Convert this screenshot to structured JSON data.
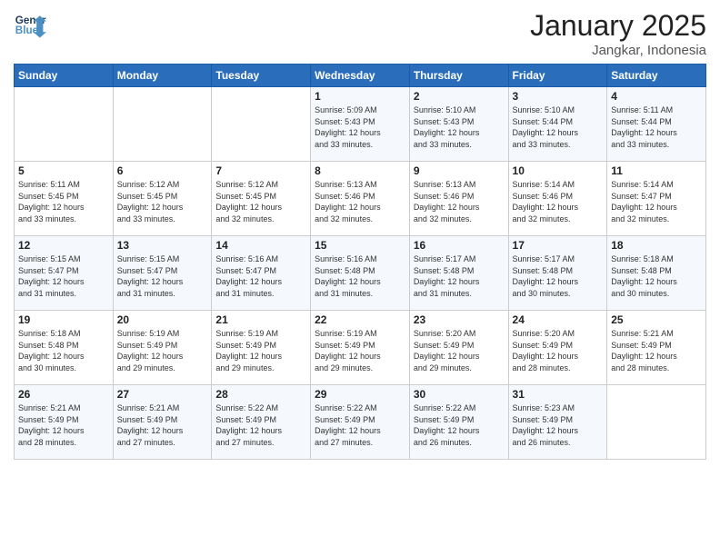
{
  "header": {
    "logo_line1": "General",
    "logo_line2": "Blue",
    "month": "January 2025",
    "location": "Jangkar, Indonesia"
  },
  "days_of_week": [
    "Sunday",
    "Monday",
    "Tuesday",
    "Wednesday",
    "Thursday",
    "Friday",
    "Saturday"
  ],
  "weeks": [
    [
      {
        "day": "",
        "info": ""
      },
      {
        "day": "",
        "info": ""
      },
      {
        "day": "",
        "info": ""
      },
      {
        "day": "1",
        "info": "Sunrise: 5:09 AM\nSunset: 5:43 PM\nDaylight: 12 hours\nand 33 minutes."
      },
      {
        "day": "2",
        "info": "Sunrise: 5:10 AM\nSunset: 5:43 PM\nDaylight: 12 hours\nand 33 minutes."
      },
      {
        "day": "3",
        "info": "Sunrise: 5:10 AM\nSunset: 5:44 PM\nDaylight: 12 hours\nand 33 minutes."
      },
      {
        "day": "4",
        "info": "Sunrise: 5:11 AM\nSunset: 5:44 PM\nDaylight: 12 hours\nand 33 minutes."
      }
    ],
    [
      {
        "day": "5",
        "info": "Sunrise: 5:11 AM\nSunset: 5:45 PM\nDaylight: 12 hours\nand 33 minutes."
      },
      {
        "day": "6",
        "info": "Sunrise: 5:12 AM\nSunset: 5:45 PM\nDaylight: 12 hours\nand 33 minutes."
      },
      {
        "day": "7",
        "info": "Sunrise: 5:12 AM\nSunset: 5:45 PM\nDaylight: 12 hours\nand 32 minutes."
      },
      {
        "day": "8",
        "info": "Sunrise: 5:13 AM\nSunset: 5:46 PM\nDaylight: 12 hours\nand 32 minutes."
      },
      {
        "day": "9",
        "info": "Sunrise: 5:13 AM\nSunset: 5:46 PM\nDaylight: 12 hours\nand 32 minutes."
      },
      {
        "day": "10",
        "info": "Sunrise: 5:14 AM\nSunset: 5:46 PM\nDaylight: 12 hours\nand 32 minutes."
      },
      {
        "day": "11",
        "info": "Sunrise: 5:14 AM\nSunset: 5:47 PM\nDaylight: 12 hours\nand 32 minutes."
      }
    ],
    [
      {
        "day": "12",
        "info": "Sunrise: 5:15 AM\nSunset: 5:47 PM\nDaylight: 12 hours\nand 31 minutes."
      },
      {
        "day": "13",
        "info": "Sunrise: 5:15 AM\nSunset: 5:47 PM\nDaylight: 12 hours\nand 31 minutes."
      },
      {
        "day": "14",
        "info": "Sunrise: 5:16 AM\nSunset: 5:47 PM\nDaylight: 12 hours\nand 31 minutes."
      },
      {
        "day": "15",
        "info": "Sunrise: 5:16 AM\nSunset: 5:48 PM\nDaylight: 12 hours\nand 31 minutes."
      },
      {
        "day": "16",
        "info": "Sunrise: 5:17 AM\nSunset: 5:48 PM\nDaylight: 12 hours\nand 31 minutes."
      },
      {
        "day": "17",
        "info": "Sunrise: 5:17 AM\nSunset: 5:48 PM\nDaylight: 12 hours\nand 30 minutes."
      },
      {
        "day": "18",
        "info": "Sunrise: 5:18 AM\nSunset: 5:48 PM\nDaylight: 12 hours\nand 30 minutes."
      }
    ],
    [
      {
        "day": "19",
        "info": "Sunrise: 5:18 AM\nSunset: 5:48 PM\nDaylight: 12 hours\nand 30 minutes."
      },
      {
        "day": "20",
        "info": "Sunrise: 5:19 AM\nSunset: 5:49 PM\nDaylight: 12 hours\nand 29 minutes."
      },
      {
        "day": "21",
        "info": "Sunrise: 5:19 AM\nSunset: 5:49 PM\nDaylight: 12 hours\nand 29 minutes."
      },
      {
        "day": "22",
        "info": "Sunrise: 5:19 AM\nSunset: 5:49 PM\nDaylight: 12 hours\nand 29 minutes."
      },
      {
        "day": "23",
        "info": "Sunrise: 5:20 AM\nSunset: 5:49 PM\nDaylight: 12 hours\nand 29 minutes."
      },
      {
        "day": "24",
        "info": "Sunrise: 5:20 AM\nSunset: 5:49 PM\nDaylight: 12 hours\nand 28 minutes."
      },
      {
        "day": "25",
        "info": "Sunrise: 5:21 AM\nSunset: 5:49 PM\nDaylight: 12 hours\nand 28 minutes."
      }
    ],
    [
      {
        "day": "26",
        "info": "Sunrise: 5:21 AM\nSunset: 5:49 PM\nDaylight: 12 hours\nand 28 minutes."
      },
      {
        "day": "27",
        "info": "Sunrise: 5:21 AM\nSunset: 5:49 PM\nDaylight: 12 hours\nand 27 minutes."
      },
      {
        "day": "28",
        "info": "Sunrise: 5:22 AM\nSunset: 5:49 PM\nDaylight: 12 hours\nand 27 minutes."
      },
      {
        "day": "29",
        "info": "Sunrise: 5:22 AM\nSunset: 5:49 PM\nDaylight: 12 hours\nand 27 minutes."
      },
      {
        "day": "30",
        "info": "Sunrise: 5:22 AM\nSunset: 5:49 PM\nDaylight: 12 hours\nand 26 minutes."
      },
      {
        "day": "31",
        "info": "Sunrise: 5:23 AM\nSunset: 5:49 PM\nDaylight: 12 hours\nand 26 minutes."
      },
      {
        "day": "",
        "info": ""
      }
    ]
  ]
}
